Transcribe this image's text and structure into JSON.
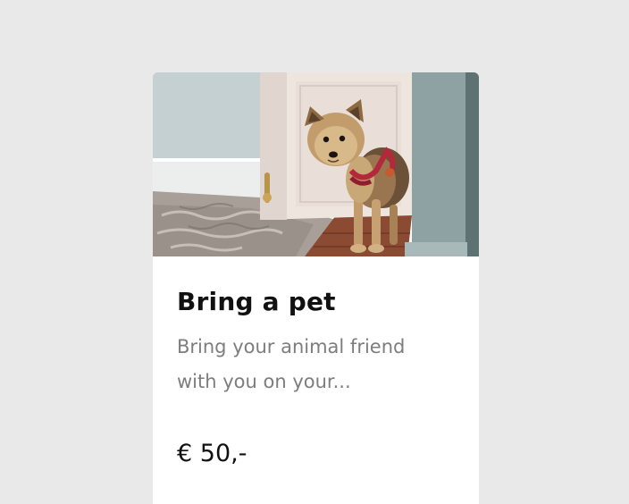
{
  "card": {
    "image_alt": "Small terrier dog with red harness standing in a doorway",
    "title": "Bring a pet",
    "description": "Bring your animal friend with you on your...",
    "price": "€ 50,-"
  },
  "colors": {
    "page_background": "#e9e9e9",
    "card_background": "#ffffff",
    "title_text": "#111111",
    "description_text": "#7d7d7d",
    "price_text": "#111111"
  }
}
